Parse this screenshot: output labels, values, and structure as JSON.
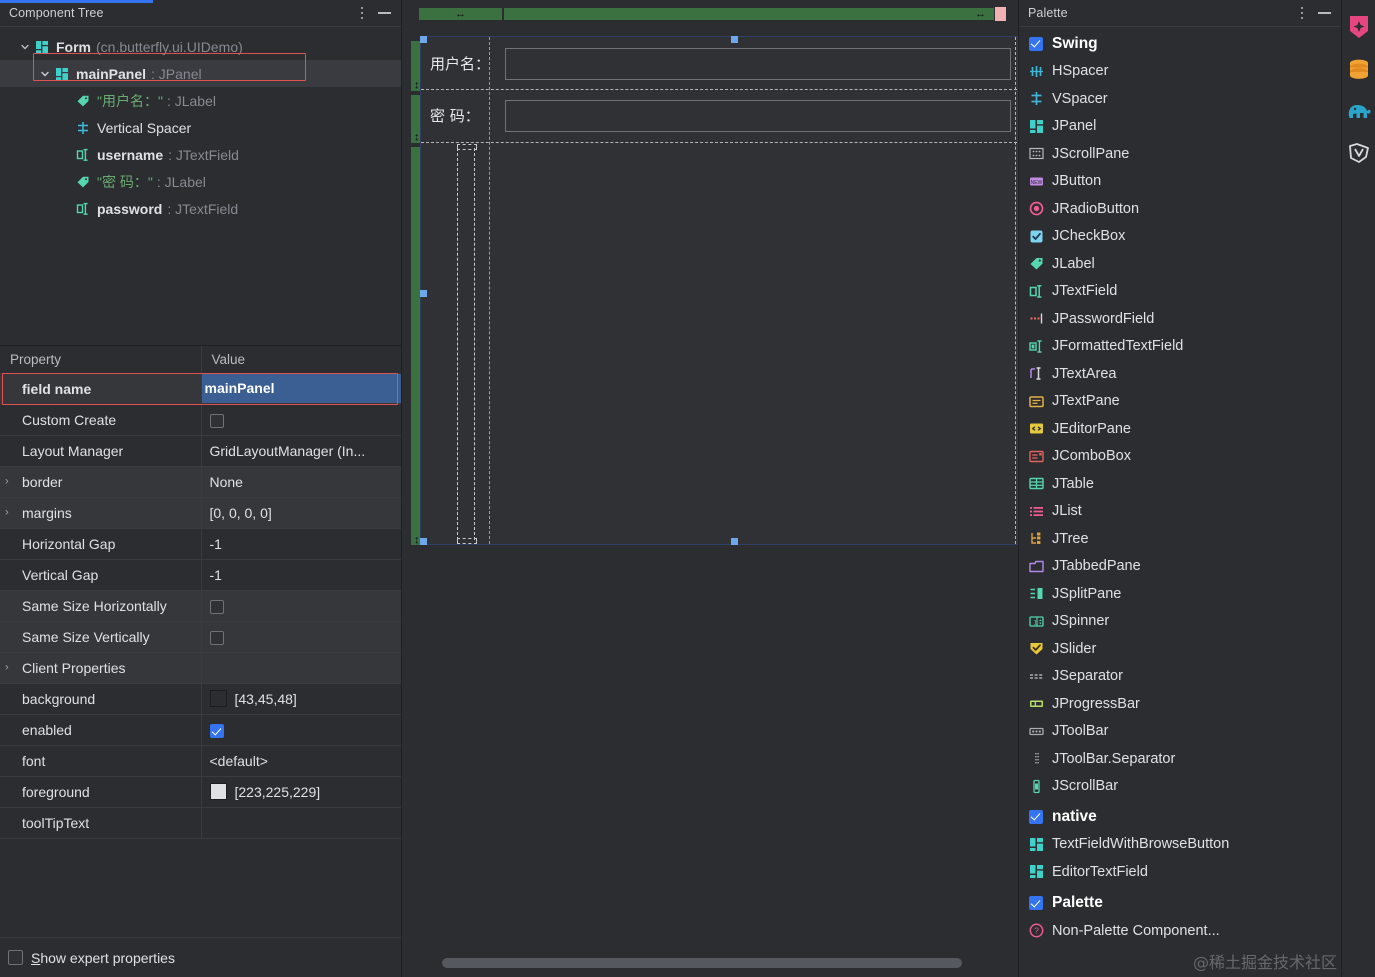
{
  "left": {
    "header": {
      "title": "Component Tree",
      "menu_icon": "kebab-menu-icon",
      "minimize_icon": "minimize-icon"
    },
    "tree": [
      {
        "indent": 0,
        "chevron": "down",
        "icon": "jpanel-icon",
        "name": "Form",
        "type": "(cn.butterfly.ui.UIDemo)",
        "type_style": "paren",
        "selected": false
      },
      {
        "indent": 1,
        "chevron": "down",
        "icon": "jpanel-icon",
        "name": "mainPanel",
        "type": ": JPanel",
        "type_style": "type",
        "selected": true
      },
      {
        "indent": 2,
        "chevron": "none",
        "icon": "jlabel-icon",
        "name": "\"用户名：\"",
        "type": ": JLabel",
        "type_style": "type",
        "name_style": "string"
      },
      {
        "indent": 2,
        "chevron": "none",
        "icon": "vspacer-icon",
        "name": "Vertical Spacer",
        "type": "",
        "type_style": "plain"
      },
      {
        "indent": 2,
        "chevron": "none",
        "icon": "jtextfield-icon",
        "name": "username",
        "type": ": JTextField",
        "type_style": "type"
      },
      {
        "indent": 2,
        "chevron": "none",
        "icon": "jlabel-icon",
        "name": "\"密  码：\"",
        "type": ": JLabel",
        "type_style": "type",
        "name_style": "string"
      },
      {
        "indent": 2,
        "chevron": "none",
        "icon": "jtextfield-icon",
        "name": "password",
        "type": ": JTextField",
        "type_style": "type"
      }
    ],
    "properties": {
      "col_property": "Property",
      "col_value": "Value",
      "rows": [
        {
          "name": "field name",
          "bold": true,
          "expand": false,
          "shade": true,
          "value": "mainPanel",
          "value_kind": "selected-text",
          "highlight": true
        },
        {
          "name": "Custom Create",
          "bold": false,
          "expand": false,
          "shade": false,
          "value": "",
          "value_kind": "checkbox",
          "checked": false
        },
        {
          "name": "Layout Manager",
          "bold": false,
          "expand": false,
          "shade": false,
          "value": "GridLayoutManager (In...",
          "value_kind": "text"
        },
        {
          "name": "border",
          "bold": false,
          "expand": true,
          "shade": true,
          "value": "None",
          "value_kind": "text"
        },
        {
          "name": "margins",
          "bold": false,
          "expand": true,
          "shade": true,
          "value": "[0, 0, 0, 0]",
          "value_kind": "text"
        },
        {
          "name": "Horizontal Gap",
          "bold": false,
          "expand": false,
          "shade": false,
          "value": "-1",
          "value_kind": "text"
        },
        {
          "name": "Vertical Gap",
          "bold": false,
          "expand": false,
          "shade": false,
          "value": "-1",
          "value_kind": "text"
        },
        {
          "name": "Same Size Horizontally",
          "bold": false,
          "expand": false,
          "shade": true,
          "value": "",
          "value_kind": "checkbox",
          "checked": false
        },
        {
          "name": "Same Size Vertically",
          "bold": false,
          "expand": false,
          "shade": true,
          "value": "",
          "value_kind": "checkbox",
          "checked": false
        },
        {
          "name": "Client Properties",
          "bold": false,
          "expand": true,
          "shade": true,
          "value": "",
          "value_kind": "text"
        },
        {
          "name": "background",
          "bold": false,
          "expand": false,
          "shade": false,
          "value": "[43,45,48]",
          "value_kind": "color",
          "swatch": "#2b2d30"
        },
        {
          "name": "enabled",
          "bold": false,
          "expand": false,
          "shade": false,
          "value": "",
          "value_kind": "checkbox",
          "checked": true
        },
        {
          "name": "font",
          "bold": false,
          "expand": false,
          "shade": false,
          "value": "<default>",
          "value_kind": "text"
        },
        {
          "name": "foreground",
          "bold": false,
          "expand": false,
          "shade": false,
          "value": "[223,225,229]",
          "value_kind": "color",
          "swatch": "#dfe1e5"
        },
        {
          "name": "toolTipText",
          "bold": false,
          "expand": false,
          "shade": false,
          "value": "",
          "value_kind": "text"
        }
      ]
    },
    "footer": {
      "checkbox_label_mnemonic": "S",
      "checkbox_label_rest": "how expert properties",
      "checked": false
    }
  },
  "canvas": {
    "labels": [
      {
        "text": "用户名：",
        "row": 0
      },
      {
        "text": "密  码：",
        "row": 1
      }
    ],
    "fields": [
      {
        "name": "username",
        "row": 0
      },
      {
        "name": "password",
        "row": 1
      }
    ],
    "selected_component": "mainPanel",
    "ruler": {
      "h_segments": 2,
      "v_segments": 3,
      "resize_icon": "horizontal-resize-icon",
      "v_resize_icon": "vertical-resize-icon",
      "end_marker_color": "#f0b2b2",
      "segment_color": "#3b7040"
    },
    "selection_color": "#6fa8ea",
    "grid_line_color": "#b4b6ba"
  },
  "right": {
    "header": {
      "title": "Palette",
      "menu_icon": "kebab-menu-icon",
      "minimize_icon": "minimize-icon"
    },
    "groups": [
      {
        "label": "Swing",
        "checked": true,
        "items": [
          {
            "label": "HSpacer",
            "icon": "hspacer-icon"
          },
          {
            "label": "VSpacer",
            "icon": "vspacer-icon"
          },
          {
            "label": "JPanel",
            "icon": "jpanel-icon"
          },
          {
            "label": "JScrollPane",
            "icon": "jscrollpane-icon"
          },
          {
            "label": "JButton",
            "icon": "jbutton-icon"
          },
          {
            "label": "JRadioButton",
            "icon": "jradiobutton-icon"
          },
          {
            "label": "JCheckBox",
            "icon": "jcheckbox-icon"
          },
          {
            "label": "JLabel",
            "icon": "jlabel-icon"
          },
          {
            "label": "JTextField",
            "icon": "jtextfield-icon"
          },
          {
            "label": "JPasswordField",
            "icon": "jpasswordfield-icon"
          },
          {
            "label": "JFormattedTextField",
            "icon": "jformattedtextfield-icon"
          },
          {
            "label": "JTextArea",
            "icon": "jtextarea-icon"
          },
          {
            "label": "JTextPane",
            "icon": "jtextpane-icon"
          },
          {
            "label": "JEditorPane",
            "icon": "jeditorpane-icon"
          },
          {
            "label": "JComboBox",
            "icon": "jcombobox-icon"
          },
          {
            "label": "JTable",
            "icon": "jtable-icon"
          },
          {
            "label": "JList",
            "icon": "jlist-icon"
          },
          {
            "label": "JTree",
            "icon": "jtree-icon"
          },
          {
            "label": "JTabbedPane",
            "icon": "jtabbedpane-icon"
          },
          {
            "label": "JSplitPane",
            "icon": "jsplitpane-icon"
          },
          {
            "label": "JSpinner",
            "icon": "jspinner-icon"
          },
          {
            "label": "JSlider",
            "icon": "jslider-icon"
          },
          {
            "label": "JSeparator",
            "icon": "jseparator-icon"
          },
          {
            "label": "JProgressBar",
            "icon": "jprogressbar-icon"
          },
          {
            "label": "JToolBar",
            "icon": "jtoolbar-icon"
          },
          {
            "label": "JToolBar.Separator",
            "icon": "jtoolbar-separator-icon"
          },
          {
            "label": "JScrollBar",
            "icon": "jscrollbar-icon"
          }
        ]
      },
      {
        "label": "native",
        "checked": true,
        "items": [
          {
            "label": "TextFieldWithBrowseButton",
            "icon": "jpanel-icon"
          },
          {
            "label": "EditorTextField",
            "icon": "jpanel-icon"
          }
        ]
      },
      {
        "label": "Palette",
        "checked": true,
        "items": [
          {
            "label": "Non-Palette Component...",
            "icon": "question-help-icon"
          }
        ]
      }
    ]
  },
  "rail": {
    "icons": [
      {
        "name": "bean-validation-icon",
        "color": "#e5467f"
      },
      {
        "name": "database-icon",
        "color": "#f0a233"
      },
      {
        "name": "postgresql-elephant-icon",
        "color": "#2aa5c9"
      },
      {
        "name": "vuejs-icon",
        "color": "#d6d8dc"
      }
    ]
  },
  "watermark": {
    "text": "@稀土掘金技术社区"
  }
}
